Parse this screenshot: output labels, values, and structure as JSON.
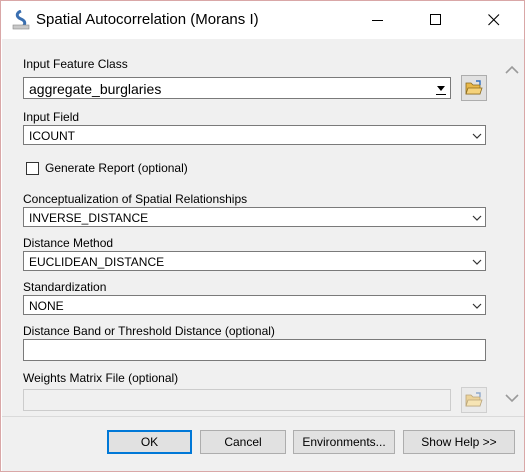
{
  "window": {
    "title": "Spatial Autocorrelation (Morans I)",
    "icon": "arcgis-tool-icon",
    "controls": [
      "minimize-icon",
      "maximize-icon",
      "close-icon"
    ]
  },
  "form": {
    "input_feature_class": {
      "label": "Input Feature Class",
      "value": "aggregate_burglaries"
    },
    "input_field": {
      "label": "Input Field",
      "value": "ICOUNT"
    },
    "generate_report": {
      "label": "Generate Report (optional)",
      "checked": false
    },
    "conceptualization": {
      "label": "Conceptualization of Spatial Relationships",
      "value": "INVERSE_DISTANCE"
    },
    "distance_method": {
      "label": "Distance Method",
      "value": "EUCLIDEAN_DISTANCE"
    },
    "standardization": {
      "label": "Standardization",
      "value": "NONE"
    },
    "distance_band": {
      "label": "Distance Band or Threshold Distance (optional)",
      "value": ""
    },
    "weights_matrix": {
      "label": "Weights Matrix File (optional)",
      "value": ""
    }
  },
  "buttons": {
    "ok": "OK",
    "cancel": "Cancel",
    "environments": "Environments...",
    "show_help": "Show Help >>"
  },
  "colors": {
    "accent": "#0078d7",
    "panel": "#f0f0f0",
    "folder": "#e8b84a"
  }
}
